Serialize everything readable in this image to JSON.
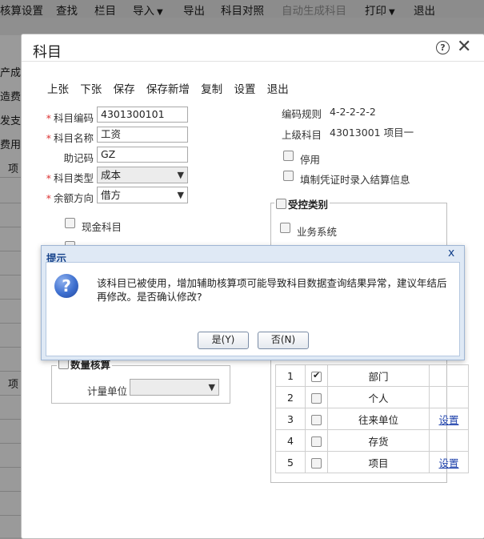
{
  "menubar": {
    "items": [
      {
        "label": "核算设置",
        "dropdown": false,
        "disabled": false
      },
      {
        "label": "查找",
        "dropdown": false,
        "disabled": false
      },
      {
        "label": "栏目",
        "dropdown": false,
        "disabled": false
      },
      {
        "label": "导入",
        "dropdown": true,
        "disabled": false
      },
      {
        "label": "导出",
        "dropdown": false,
        "disabled": false
      },
      {
        "label": "科目对照",
        "dropdown": false,
        "disabled": false
      },
      {
        "label": "自动生成科目",
        "dropdown": false,
        "disabled": true
      },
      {
        "label": "打印",
        "dropdown": true,
        "disabled": false
      },
      {
        "label": "退出",
        "dropdown": false,
        "disabled": false
      }
    ]
  },
  "background_side": [
    "产成",
    "造费",
    "发支",
    "费用",
    "项",
    "项"
  ],
  "dialog": {
    "title": "科目",
    "help_glyph": "?",
    "close_glyph": "✕",
    "toolbar": [
      "上张",
      "下张",
      "保存",
      "保存新增",
      "复制",
      "设置",
      "退出"
    ]
  },
  "form": {
    "code_label": "科目编码",
    "code_value": "4301300101",
    "name_label": "科目名称",
    "name_value": "工资",
    "mnemonic_label": "助记码",
    "mnemonic_value": "GZ",
    "type_label": "科目类型",
    "type_value": "成本",
    "balance_label": "余额方向",
    "balance_value": "借方",
    "cash_label": "现金科目",
    "coding_rule_label": "编码规则",
    "coding_rule_value": "4-2-2-2-2",
    "parent_label": "上级科目",
    "parent_value": "43013001 项目一",
    "disabled_label": "停用",
    "voucher_label": "填制凭证时录入结算信息",
    "controlled_label": "受控类别",
    "business_label": "业务系统",
    "quantity_label": "数量核算",
    "unit_label": "计量单位",
    "unit_value": ""
  },
  "aux_table": {
    "rows": [
      {
        "no": "1",
        "checked": true,
        "name": "部门",
        "link": ""
      },
      {
        "no": "2",
        "checked": false,
        "name": "个人",
        "link": ""
      },
      {
        "no": "3",
        "checked": false,
        "name": "往来单位",
        "link": "设置"
      },
      {
        "no": "4",
        "checked": false,
        "name": "存货",
        "link": ""
      },
      {
        "no": "5",
        "checked": false,
        "name": "项目",
        "link": "设置"
      }
    ]
  },
  "prompt": {
    "title": "提示",
    "close_glyph": "x",
    "message": "该科目已被使用，增加辅助核算项可能导致科目数据查询结果异常，建议年结后再修改。是否确认修改?",
    "yes_label": "是(Y)",
    "no_label": "否(N)"
  },
  "colors": {
    "prompt_title": "#15428b",
    "prompt_bg": "#dfe9f5",
    "link": "#1b3faa",
    "required_mark": "#d33"
  }
}
